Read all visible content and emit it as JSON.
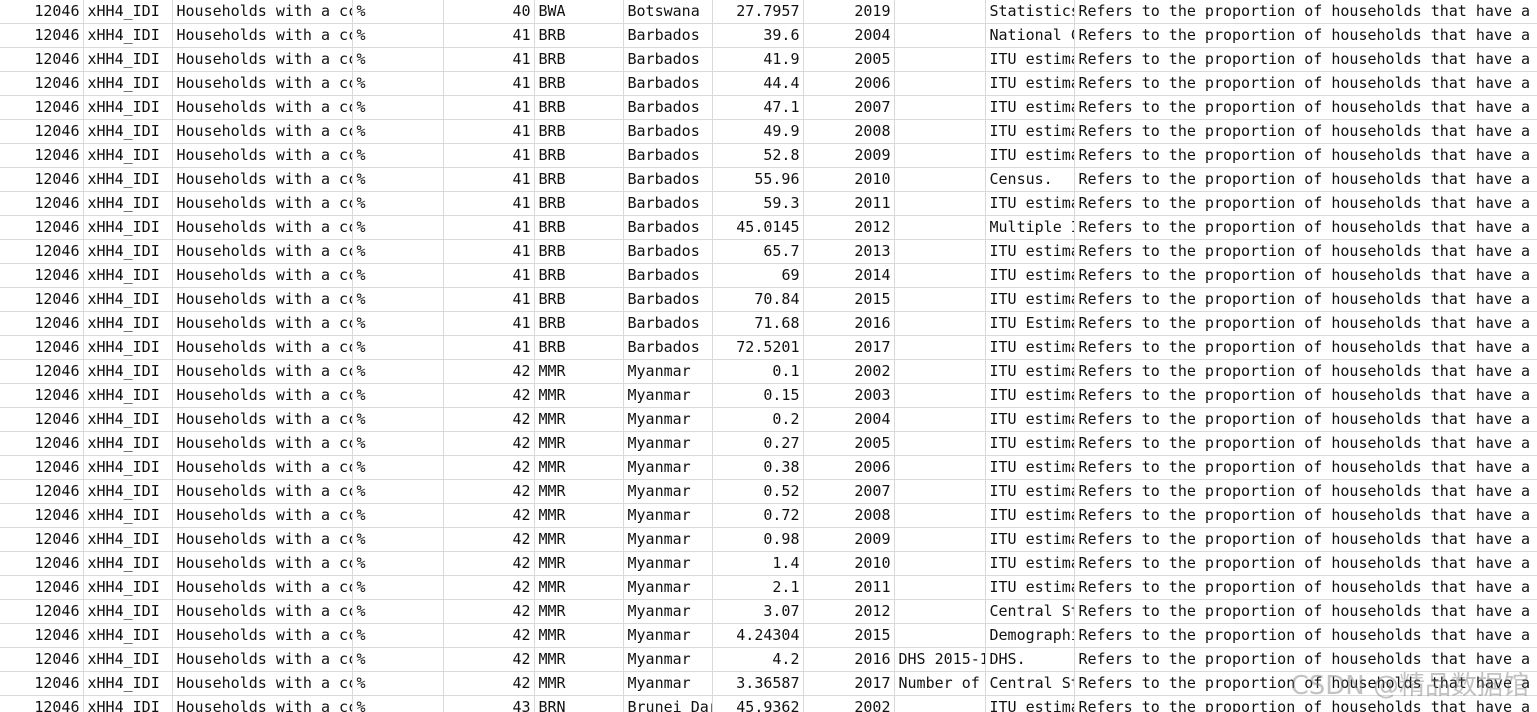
{
  "table": {
    "rows": [
      [
        "12046",
        "xHH4_IDI",
        "Households with a cc",
        "%",
        "40",
        "BWA",
        "Botswana",
        "27.7957",
        "2019",
        "",
        "Statistics",
        "Refers to the proportion of households that have a c"
      ],
      [
        "12046",
        "xHH4_IDI",
        "Households with a cc",
        "%",
        "41",
        "BRB",
        "Barbados",
        "39.6",
        "2004",
        "",
        "National C",
        "Refers to the proportion of households that have a c"
      ],
      [
        "12046",
        "xHH4_IDI",
        "Households with a cc",
        "%",
        "41",
        "BRB",
        "Barbados",
        "41.9",
        "2005",
        "",
        "ITU estima",
        "Refers to the proportion of households that have a c"
      ],
      [
        "12046",
        "xHH4_IDI",
        "Households with a cc",
        "%",
        "41",
        "BRB",
        "Barbados",
        "44.4",
        "2006",
        "",
        "ITU estima",
        "Refers to the proportion of households that have a c"
      ],
      [
        "12046",
        "xHH4_IDI",
        "Households with a cc",
        "%",
        "41",
        "BRB",
        "Barbados",
        "47.1",
        "2007",
        "",
        "ITU estima",
        "Refers to the proportion of households that have a c"
      ],
      [
        "12046",
        "xHH4_IDI",
        "Households with a cc",
        "%",
        "41",
        "BRB",
        "Barbados",
        "49.9",
        "2008",
        "",
        "ITU estima",
        "Refers to the proportion of households that have a c"
      ],
      [
        "12046",
        "xHH4_IDI",
        "Households with a cc",
        "%",
        "41",
        "BRB",
        "Barbados",
        "52.8",
        "2009",
        "",
        "ITU estima",
        "Refers to the proportion of households that have a c"
      ],
      [
        "12046",
        "xHH4_IDI",
        "Households with a cc",
        "%",
        "41",
        "BRB",
        "Barbados",
        "55.96",
        "2010",
        "",
        "Census.",
        "Refers to the proportion of households that have a c"
      ],
      [
        "12046",
        "xHH4_IDI",
        "Households with a cc",
        "%",
        "41",
        "BRB",
        "Barbados",
        "59.3",
        "2011",
        "",
        "ITU estima",
        "Refers to the proportion of households that have a c"
      ],
      [
        "12046",
        "xHH4_IDI",
        "Households with a cc",
        "%",
        "41",
        "BRB",
        "Barbados",
        "45.0145",
        "2012",
        "",
        "Multiple I",
        "Refers to the proportion of households that have a c"
      ],
      [
        "12046",
        "xHH4_IDI",
        "Households with a cc",
        "%",
        "41",
        "BRB",
        "Barbados",
        "65.7",
        "2013",
        "",
        "ITU estima",
        "Refers to the proportion of households that have a c"
      ],
      [
        "12046",
        "xHH4_IDI",
        "Households with a cc",
        "%",
        "41",
        "BRB",
        "Barbados",
        "69",
        "2014",
        "",
        "ITU estima",
        "Refers to the proportion of households that have a c"
      ],
      [
        "12046",
        "xHH4_IDI",
        "Households with a cc",
        "%",
        "41",
        "BRB",
        "Barbados",
        "70.84",
        "2015",
        "",
        "ITU estima",
        "Refers to the proportion of households that have a c"
      ],
      [
        "12046",
        "xHH4_IDI",
        "Households with a cc",
        "%",
        "41",
        "BRB",
        "Barbados",
        "71.68",
        "2016",
        "",
        "ITU Estima",
        "Refers to the proportion of households that have a c"
      ],
      [
        "12046",
        "xHH4_IDI",
        "Households with a cc",
        "%",
        "41",
        "BRB",
        "Barbados",
        "72.5201",
        "2017",
        "",
        "ITU estima",
        "Refers to the proportion of households that have a c"
      ],
      [
        "12046",
        "xHH4_IDI",
        "Households with a cc",
        "%",
        "42",
        "MMR",
        "Myanmar",
        "0.1",
        "2002",
        "",
        "ITU estima",
        "Refers to the proportion of households that have a c"
      ],
      [
        "12046",
        "xHH4_IDI",
        "Households with a cc",
        "%",
        "42",
        "MMR",
        "Myanmar",
        "0.15",
        "2003",
        "",
        "ITU estima",
        "Refers to the proportion of households that have a c"
      ],
      [
        "12046",
        "xHH4_IDI",
        "Households with a cc",
        "%",
        "42",
        "MMR",
        "Myanmar",
        "0.2",
        "2004",
        "",
        "ITU estima",
        "Refers to the proportion of households that have a c"
      ],
      [
        "12046",
        "xHH4_IDI",
        "Households with a cc",
        "%",
        "42",
        "MMR",
        "Myanmar",
        "0.27",
        "2005",
        "",
        "ITU estima",
        "Refers to the proportion of households that have a c"
      ],
      [
        "12046",
        "xHH4_IDI",
        "Households with a cc",
        "%",
        "42",
        "MMR",
        "Myanmar",
        "0.38",
        "2006",
        "",
        "ITU estima",
        "Refers to the proportion of households that have a c"
      ],
      [
        "12046",
        "xHH4_IDI",
        "Households with a cc",
        "%",
        "42",
        "MMR",
        "Myanmar",
        "0.52",
        "2007",
        "",
        "ITU estima",
        "Refers to the proportion of households that have a c"
      ],
      [
        "12046",
        "xHH4_IDI",
        "Households with a cc",
        "%",
        "42",
        "MMR",
        "Myanmar",
        "0.72",
        "2008",
        "",
        "ITU estima",
        "Refers to the proportion of households that have a c"
      ],
      [
        "12046",
        "xHH4_IDI",
        "Households with a cc",
        "%",
        "42",
        "MMR",
        "Myanmar",
        "0.98",
        "2009",
        "",
        "ITU estima",
        "Refers to the proportion of households that have a c"
      ],
      [
        "12046",
        "xHH4_IDI",
        "Households with a cc",
        "%",
        "42",
        "MMR",
        "Myanmar",
        "1.4",
        "2010",
        "",
        "ITU estima",
        "Refers to the proportion of households that have a c"
      ],
      [
        "12046",
        "xHH4_IDI",
        "Households with a cc",
        "%",
        "42",
        "MMR",
        "Myanmar",
        "2.1",
        "2011",
        "",
        "ITU estima",
        "Refers to the proportion of households that have a c"
      ],
      [
        "12046",
        "xHH4_IDI",
        "Households with a cc",
        "%",
        "42",
        "MMR",
        "Myanmar",
        "3.07",
        "2012",
        "",
        "Central St",
        "Refers to the proportion of households that have a c"
      ],
      [
        "12046",
        "xHH4_IDI",
        "Households with a cc",
        "%",
        "42",
        "MMR",
        "Myanmar",
        "4.24304",
        "2015",
        "",
        "Demographi",
        "Refers to the proportion of households that have a c"
      ],
      [
        "12046",
        "xHH4_IDI",
        "Households with a cc",
        "%",
        "42",
        "MMR",
        "Myanmar",
        "4.2",
        "2016",
        "DHS 2015-1",
        "DHS.",
        "Refers to the proportion of households that have a c"
      ],
      [
        "12046",
        "xHH4_IDI",
        "Households with a cc",
        "%",
        "42",
        "MMR",
        "Myanmar",
        "3.36587",
        "2017",
        "Number of",
        "Central St",
        "Refers to the proportion of households that have a c"
      ],
      [
        "12046",
        "xHH4_IDI",
        "Households with a cc",
        "%",
        "43",
        "BRN",
        "Brunei Dar",
        "45.9362",
        "2002",
        "",
        "ITU estima",
        "Refers to the proportion of households that have a c"
      ]
    ]
  },
  "watermark": "CSDN @精品数据馆"
}
